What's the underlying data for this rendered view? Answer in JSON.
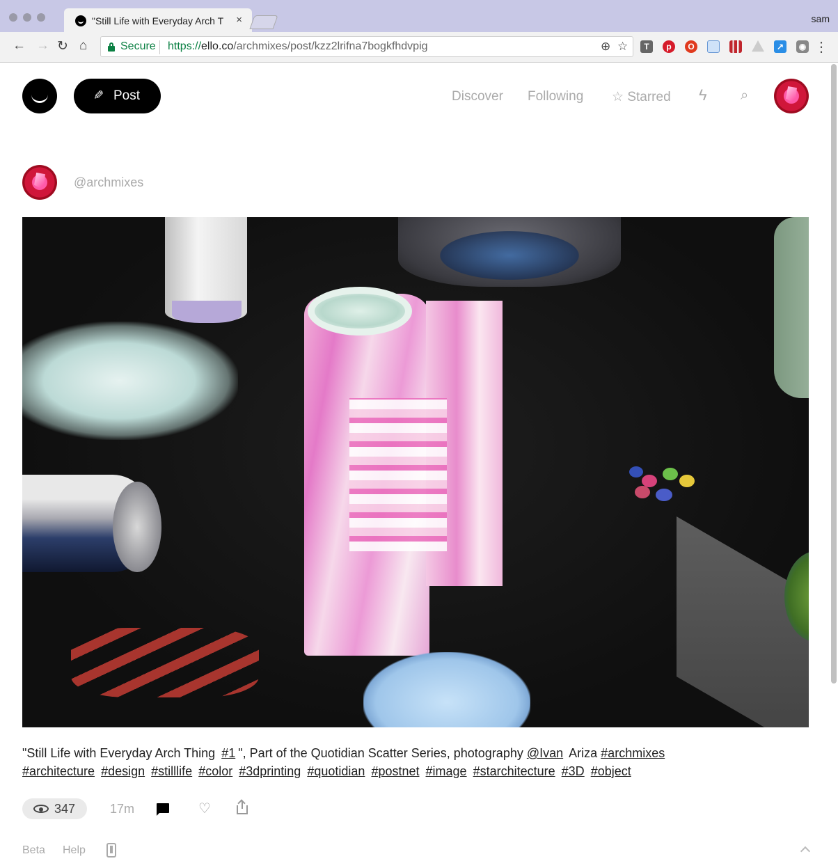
{
  "browser": {
    "tab_title": "\"Still Life with Everyday Arch T",
    "tab_close": "×",
    "profile_name": "sam",
    "secure_label": "Secure",
    "url_scheme": "https://",
    "url_host": "ello.co",
    "url_path": "/archmixes/post/kzz2lrifna7bogkfhdvpig",
    "back_icon": "arrow-left-icon",
    "forward_icon": "arrow-right-icon",
    "reload_icon": "reload-icon",
    "home_icon": "home-icon"
  },
  "header": {
    "post_label": "Post",
    "nav": {
      "discover": "Discover",
      "following": "Following",
      "starred": "Starred"
    }
  },
  "post": {
    "username": "@archmixes",
    "image_alt": "3D printed pink and white architectural model among everyday objects on black background",
    "caption": [
      {
        "text": "\"Still Life with Everyday Arch Thing ",
        "link": false
      },
      {
        "text": "#1",
        "link": true
      },
      {
        "text": "\", Part of the Quotidian Scatter Series, photography ",
        "link": false
      },
      {
        "text": "@Ivan",
        "link": true
      },
      {
        "text": " Ariza ",
        "link": false
      },
      {
        "text": "#archmixes",
        "link": true
      }
    ],
    "tags": [
      "#architecture",
      "#design",
      "#stilllife",
      "#color",
      "#3dprinting",
      "#quotidian",
      "#postnet",
      "#image",
      "#starchitecture",
      "#3D",
      "#object"
    ],
    "views": "347",
    "time": "17m"
  },
  "footer": {
    "beta": "Beta",
    "help": "Help"
  },
  "colors": {
    "secure_green": "#0b8043",
    "ello_black": "#000000",
    "muted_text": "#aaaaaa"
  }
}
